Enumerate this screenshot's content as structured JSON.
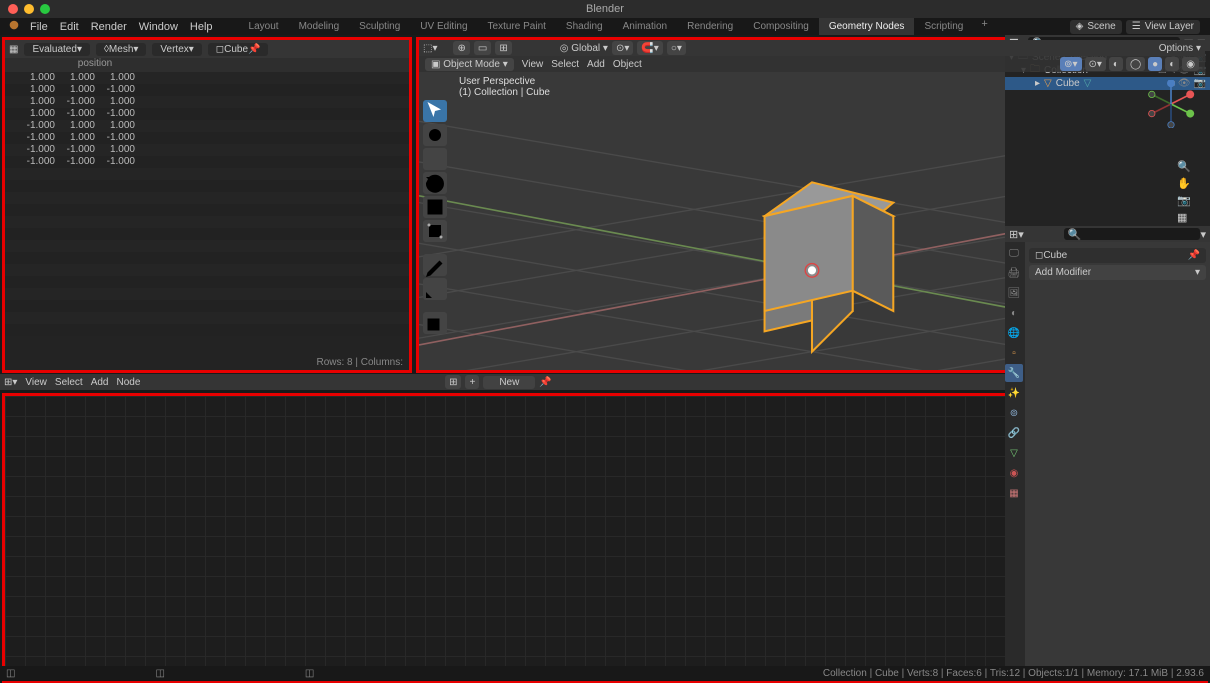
{
  "app_title": "Blender",
  "menu": [
    "File",
    "Edit",
    "Render",
    "Window",
    "Help"
  ],
  "workspace_tabs": [
    "Layout",
    "Modeling",
    "Sculpting",
    "UV Editing",
    "Texture Paint",
    "Shading",
    "Animation",
    "Rendering",
    "Compositing",
    "Geometry Nodes",
    "Scripting"
  ],
  "active_workspace": "Geometry Nodes",
  "scene_label": "Scene",
  "view_layer_label": "View Layer",
  "spreadsheet": {
    "eval_label": "Evaluated",
    "mesh_label": "Mesh",
    "vertex_label": "Vertex",
    "obj_label": "Cube",
    "column": "position",
    "rows": [
      [
        "1.000",
        "1.000",
        "1.000"
      ],
      [
        "1.000",
        "1.000",
        "-1.000"
      ],
      [
        "1.000",
        "-1.000",
        "1.000"
      ],
      [
        "1.000",
        "-1.000",
        "-1.000"
      ],
      [
        "-1.000",
        "1.000",
        "1.000"
      ],
      [
        "-1.000",
        "1.000",
        "-1.000"
      ],
      [
        "-1.000",
        "-1.000",
        "1.000"
      ],
      [
        "-1.000",
        "-1.000",
        "-1.000"
      ]
    ],
    "footer": "Rows: 8  |  Columns:"
  },
  "viewport": {
    "mode": "Object Mode",
    "menus": [
      "View",
      "Select",
      "Add",
      "Object"
    ],
    "orient": "Global",
    "persp_line1": "User Perspective",
    "persp_line2": "(1) Collection | Cube",
    "options": "Options"
  },
  "node_editor": {
    "menus": [
      "View",
      "Select",
      "Add",
      "Node"
    ],
    "new": "New"
  },
  "outliner": {
    "scene": "Scene Collection",
    "collection": "Collection",
    "object": "Cube"
  },
  "properties": {
    "obj_name": "Cube",
    "add_mod": "Add Modifier"
  },
  "status": "Collection | Cube | Verts:8 | Faces:6 | Tris:12 | Objects:1/1 | Memory: 17.1 MiB | 2.93.6"
}
